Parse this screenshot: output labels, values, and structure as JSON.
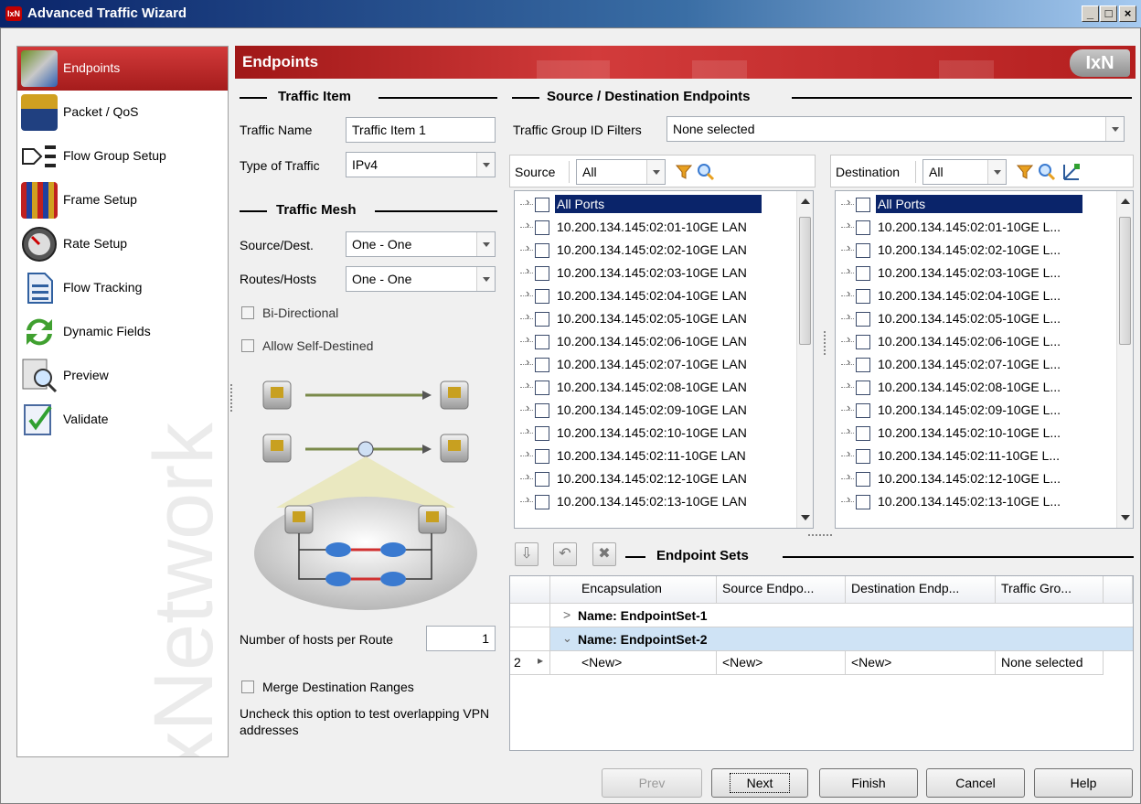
{
  "window": {
    "title": "Advanced Traffic Wizard",
    "app_icon": "IxN"
  },
  "nav": {
    "watermark": "IxNetwork",
    "items": [
      {
        "label": "Endpoints",
        "icon": "endpoints-icon",
        "active": true
      },
      {
        "label": "Packet / QoS",
        "icon": "packet-qos-icon"
      },
      {
        "label": "Flow Group Setup",
        "icon": "flow-group-icon"
      },
      {
        "label": "Frame Setup",
        "icon": "frame-setup-icon"
      },
      {
        "label": "Rate Setup",
        "icon": "rate-gauge-icon"
      },
      {
        "label": "Flow Tracking",
        "icon": "flow-tracking-icon"
      },
      {
        "label": "Dynamic Fields",
        "icon": "dynamic-fields-icon"
      },
      {
        "label": "Preview",
        "icon": "preview-icon"
      },
      {
        "label": "Validate",
        "icon": "validate-icon"
      }
    ]
  },
  "header": {
    "title": "Endpoints",
    "logo": "IxN"
  },
  "traffic_item": {
    "section_title": "Traffic Item",
    "name_label": "Traffic Name",
    "name_value": "Traffic Item 1",
    "type_label": "Type of Traffic",
    "type_value": "IPv4"
  },
  "traffic_mesh": {
    "section_title": "Traffic Mesh",
    "src_dest_label": "Source/Dest.",
    "src_dest_value": "One - One",
    "routes_label": "Routes/Hosts",
    "routes_value": "One - One",
    "bidirectional_label": "Bi-Directional",
    "allow_self_label": "Allow Self-Destined"
  },
  "hosts": {
    "label": "Number of hosts per Route",
    "value": "1"
  },
  "merge": {
    "label": "Merge Destination Ranges",
    "hint": "Uncheck this option to test overlapping VPN addresses"
  },
  "endpoints": {
    "section_title": "Source / Destination Endpoints",
    "filter_label": "Traffic Group ID Filters",
    "filter_value": "None selected",
    "source_label": "Source",
    "source_filter": "All",
    "dest_label": "Destination",
    "dest_filter": "All",
    "source_ports": [
      "All Ports",
      "10.200.134.145:02:01-10GE LAN",
      "10.200.134.145:02:02-10GE LAN",
      "10.200.134.145:02:03-10GE LAN",
      "10.200.134.145:02:04-10GE LAN",
      "10.200.134.145:02:05-10GE LAN",
      "10.200.134.145:02:06-10GE LAN",
      "10.200.134.145:02:07-10GE LAN",
      "10.200.134.145:02:08-10GE LAN",
      "10.200.134.145:02:09-10GE LAN",
      "10.200.134.145:02:10-10GE LAN",
      "10.200.134.145:02:11-10GE LAN",
      "10.200.134.145:02:12-10GE LAN",
      "10.200.134.145:02:13-10GE LAN"
    ],
    "dest_ports": [
      "All Ports",
      "10.200.134.145:02:01-10GE L...",
      "10.200.134.145:02:02-10GE L...",
      "10.200.134.145:02:03-10GE L...",
      "10.200.134.145:02:04-10GE L...",
      "10.200.134.145:02:05-10GE L...",
      "10.200.134.145:02:06-10GE L...",
      "10.200.134.145:02:07-10GE L...",
      "10.200.134.145:02:08-10GE L...",
      "10.200.134.145:02:09-10GE L...",
      "10.200.134.145:02:10-10GE L...",
      "10.200.134.145:02:11-10GE L...",
      "10.200.134.145:02:12-10GE L...",
      "10.200.134.145:02:13-10GE L..."
    ]
  },
  "endpoint_sets": {
    "section_title": "Endpoint Sets",
    "columns": [
      "Encapsulation",
      "Source Endpo...",
      "Destination Endp...",
      "Traffic Gro..."
    ],
    "groups": [
      {
        "name": "Name: EndpointSet-1",
        "expanded": false
      },
      {
        "name": "Name: EndpointSet-2",
        "expanded": true
      }
    ],
    "row": {
      "index": "2",
      "encapsulation": "<New>",
      "source": "<New>",
      "destination": "<New>",
      "traffic_group": "None selected"
    }
  },
  "buttons": {
    "prev": "Prev",
    "next": "Next",
    "finish": "Finish",
    "cancel": "Cancel",
    "help": "Help"
  },
  "colors": {
    "accent_red": "#b41f1f",
    "selection": "#0a246a",
    "group_highlight": "#cfe3f5"
  }
}
